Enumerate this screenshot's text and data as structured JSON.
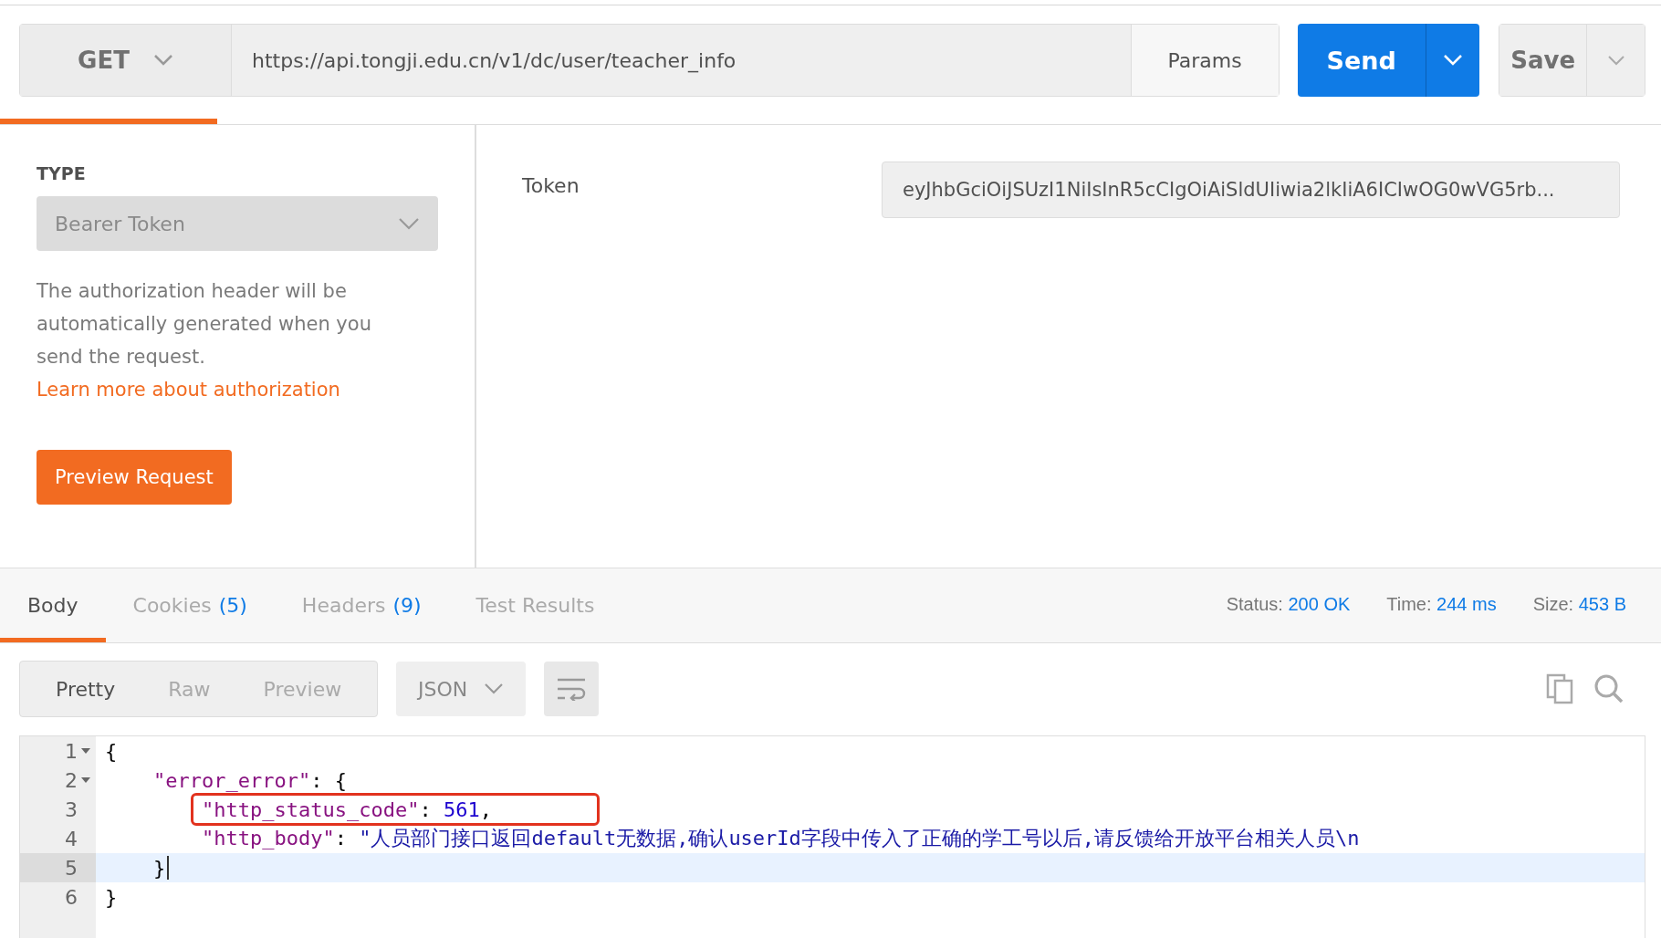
{
  "request": {
    "method": "GET",
    "url": "https://api.tongji.edu.cn/v1/dc/user/teacher_info",
    "params_button": "Params",
    "send_button": "Send",
    "save_button": "Save"
  },
  "auth": {
    "type_label": "TYPE",
    "type_value": "Bearer Token",
    "description": "The authorization header will be automatically generated when you send the request.",
    "link": "Learn more about authorization",
    "preview_button": "Preview Request",
    "token_label": "Token",
    "token_value": "eyJhbGciOiJSUzI1NiIsInR5cCIgOiAiSldUIiwia2lkIiA6ICIwOG0wVG5rb..."
  },
  "response_tabs": [
    {
      "label": "Body",
      "selected": true
    },
    {
      "label": "Cookies",
      "count": "(5)",
      "selected": false
    },
    {
      "label": "Headers",
      "count": "(9)",
      "selected": false
    },
    {
      "label": "Test Results",
      "selected": false
    }
  ],
  "response_meta": [
    {
      "label": "Status:",
      "value": "200 OK"
    },
    {
      "label": "Time:",
      "value": "244 ms"
    },
    {
      "label": "Size:",
      "value": "453 B"
    }
  ],
  "view_modes": [
    {
      "label": "Pretty",
      "selected": true
    },
    {
      "label": "Raw",
      "selected": false
    },
    {
      "label": "Preview",
      "selected": false
    }
  ],
  "format": "JSON",
  "code_lines": [
    {
      "number": "1",
      "foldable": true,
      "active": false,
      "tokens": [
        {
          "kind": "punct",
          "text": "{"
        }
      ]
    },
    {
      "number": "2",
      "foldable": true,
      "active": false,
      "tokens": [
        {
          "kind": "key",
          "text": "    \"error_error\""
        },
        {
          "kind": "punct",
          "text": ": {"
        }
      ]
    },
    {
      "number": "3",
      "foldable": false,
      "active": false,
      "tokens": [
        {
          "kind": "key",
          "text": "        \"http_status_code\""
        },
        {
          "kind": "punct",
          "text": ": "
        },
        {
          "kind": "number",
          "text": "561"
        },
        {
          "kind": "punct",
          "text": ","
        }
      ]
    },
    {
      "number": "4",
      "foldable": false,
      "active": false,
      "tokens": [
        {
          "kind": "key",
          "text": "        \"http_body\""
        },
        {
          "kind": "punct",
          "text": ": "
        },
        {
          "kind": "string",
          "text": "\"人员部门接口返回default无数据,确认userId字段中传入了正确的学工号以后,请反馈给开放平台相关人员\\n"
        }
      ]
    },
    {
      "number": "5",
      "foldable": false,
      "active": true,
      "tokens": [
        {
          "kind": "punct",
          "text": "    }"
        }
      ]
    },
    {
      "number": "6",
      "foldable": false,
      "active": false,
      "tokens": [
        {
          "kind": "punct",
          "text": "}"
        }
      ]
    }
  ]
}
